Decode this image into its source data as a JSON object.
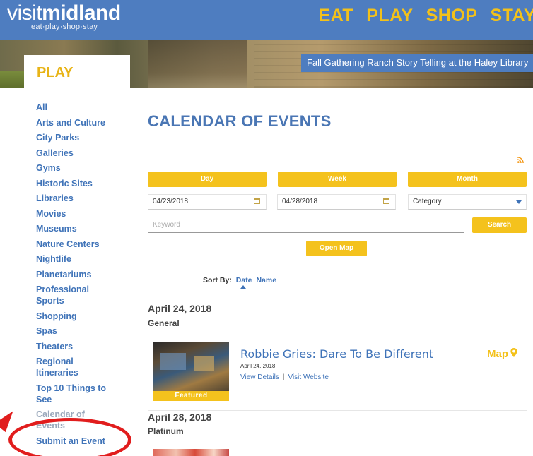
{
  "brand": {
    "logo_light": "visit",
    "logo_bold": "midland",
    "tagline": "eat·play·shop·stay"
  },
  "topnav": [
    "EAT",
    "PLAY",
    "SHOP",
    "STAY"
  ],
  "banner": {
    "caption": "Fall Gathering Ranch Story Telling at the Haley Library"
  },
  "sidebar": {
    "title": "PLAY",
    "items": [
      "All",
      "Arts and Culture",
      "City Parks",
      "Galleries",
      "Gyms",
      "Historic Sites",
      "Libraries",
      "Movies",
      "Museums",
      "Nature Centers",
      "Nightlife",
      "Planetariums",
      "Professional Sports",
      "Shopping",
      "Spas",
      "Theaters",
      "Regional Itineraries",
      "Top 10 Things to See",
      "Calendar of Events",
      "Submit an Event"
    ]
  },
  "main": {
    "title": "CALENDAR OF EVENTS",
    "tabs": [
      "Day",
      "Week",
      "Month"
    ],
    "start_date": "04/23/2018",
    "end_date": "04/28/2018",
    "category": "Category",
    "keyword_placeholder": "Keyword",
    "search_label": "Search",
    "open_map_label": "Open Map",
    "sort_label": "Sort By:",
    "sort_date": "Date",
    "sort_name": "Name"
  },
  "events": [
    {
      "date_heading": "April 24, 2018",
      "group": "General",
      "featured_label": "Featured",
      "title": "Robbie Gries: Dare To Be Different",
      "date": "April 24, 2018",
      "view_details": "View Details",
      "separator": "|",
      "visit_website": "Visit Website",
      "map_label": "Map"
    },
    {
      "date_heading": "April 28, 2018",
      "group": "Platinum"
    }
  ],
  "colors": {
    "header_blue": "#4e7dc0",
    "accent_yellow": "#f4c21d",
    "link_blue": "#3f73b8",
    "annotation_red": "#e11d1d"
  }
}
